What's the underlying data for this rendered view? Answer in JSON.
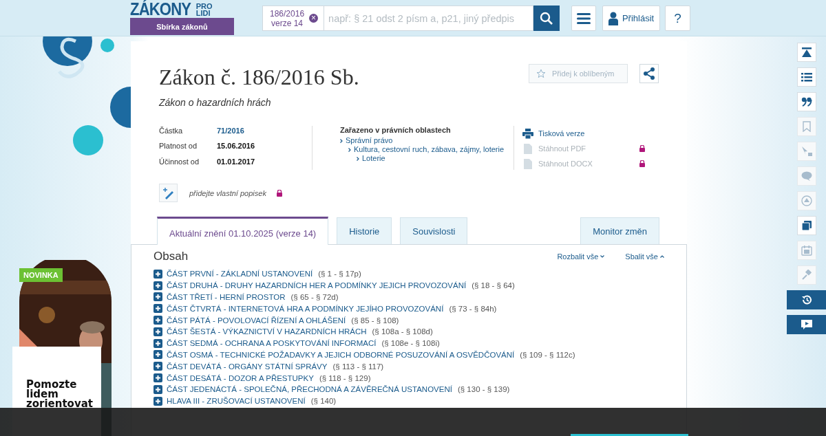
{
  "header": {
    "logo_main": "ZÁKONY",
    "logo_sub": [
      "PRO",
      "LIDI"
    ],
    "collection_button": "Sbírka zákonů",
    "search_chip": {
      "line1": "186/2016",
      "line2": "verze 14",
      "clear": "×"
    },
    "search": {
      "placeholder": "např: § 21 odst 2 písm a, p21, jiný předpis"
    },
    "login": "Přihlásit",
    "help": "?"
  },
  "document": {
    "title": "Zákon č. 186/2016 Sb.",
    "subtitle": "Zákon o hazardních hrách",
    "favorite": "Přidej k oblíbeným",
    "meta": [
      {
        "label": "Částka",
        "value": "71/2016",
        "link": true
      },
      {
        "label": "Platnost od",
        "value": "15.06.2016",
        "link": false
      },
      {
        "label": "Účinnost od",
        "value": "01.01.2017",
        "link": false
      }
    ],
    "areas_heading": "Zařazeno v právních oblastech",
    "areas": [
      {
        "label": "Správní právo",
        "children": [
          {
            "label": "Kultura, cestovní ruch, zábava, zájmy, loterie",
            "children": [
              {
                "label": "Loterie"
              }
            ]
          }
        ]
      }
    ],
    "downloads": [
      {
        "label": "Tisková verze",
        "disabled": false,
        "locked": false
      },
      {
        "label": "Stáhnout PDF",
        "disabled": true,
        "locked": true
      },
      {
        "label": "Stáhnout DOCX",
        "disabled": true,
        "locked": true
      }
    ],
    "note": {
      "text": "přidejte vlastní popisek",
      "locked": true
    }
  },
  "tabs": [
    {
      "label": "Aktuální znění 01.10.2025 (verze 14)",
      "selected": true
    },
    {
      "label": "Historie",
      "selected": false
    },
    {
      "label": "Souvislosti",
      "selected": false
    },
    {
      "label": "Monitor změn",
      "selected": false
    }
  ],
  "toc": {
    "heading": "Obsah",
    "expand_all": "Rozbalit vše",
    "collapse_all": "Sbalit vše",
    "items": [
      {
        "title": "ČÁST PRVNÍ - ZÁKLADNÍ USTANOVENÍ",
        "range": "(§ 1 - § 17p)"
      },
      {
        "title": "ČÁST DRUHÁ - DRUHY HAZARDNÍCH HER A PODMÍNKY JEJICH PROVOZOVÁNÍ",
        "range": "(§ 18 - § 64)"
      },
      {
        "title": "ČÁST TŘETÍ - HERNÍ PROSTOR",
        "range": "(§ 65 - § 72d)"
      },
      {
        "title": "ČÁST ČTVRTÁ - INTERNETOVÁ HRA A PODMÍNKY JEJÍHO PROVOZOVÁNÍ",
        "range": "(§ 73 - § 84h)"
      },
      {
        "title": "ČÁST PÁTÁ - POVOLOVACÍ ŘÍZENÍ A OHLÁŠENÍ",
        "range": "(§ 85 - § 108)"
      },
      {
        "title": "ČÁST ŠESTÁ - VÝKAZNICTVÍ V HAZARDNÍCH HRÁCH",
        "range": "(§ 108a - § 108d)"
      },
      {
        "title": "ČÁST SEDMÁ - OCHRANA A POSKYTOVÁNÍ INFORMACÍ",
        "range": "(§ 108e - § 108i)"
      },
      {
        "title": "ČÁST OSMÁ - TECHNICKÉ POŽADAVKY A JEJICH ODBORNÉ POSUZOVÁNÍ A OSVĚDČOVÁNÍ",
        "range": "(§ 109 - § 112c)"
      },
      {
        "title": "ČÁST DEVÁTÁ - ORGÁNY STÁTNÍ SPRÁVY",
        "range": "(§ 113 - § 117)"
      },
      {
        "title": "ČÁST DESÁTÁ - DOZOR A PŘESTUPKY",
        "range": "(§ 118 - § 129)"
      },
      {
        "title": "ČÁST JEDENÁCTÁ - SPOLEČNÁ, PŘECHODNÁ A ZÁVĚREČNÁ USTANOVENÍ",
        "range": "(§ 130 - § 139)"
      },
      {
        "title": "HLAVA III - ZRUŠOVACÍ USTANOVENÍ",
        "range": "(§ 140)"
      }
    ]
  },
  "rail": [
    {
      "disabled": false,
      "active": false
    },
    {
      "disabled": false,
      "active": false
    },
    {
      "disabled": false,
      "active": false
    },
    {
      "disabled": true,
      "active": false
    },
    {
      "disabled": true,
      "active": false
    },
    {
      "disabled": true,
      "active": false
    },
    {
      "disabled": true,
      "active": false
    },
    {
      "disabled": false,
      "active": false
    },
    {
      "disabled": true,
      "active": false
    },
    {
      "disabled": true,
      "active": false
    },
    {
      "disabled": false,
      "active": true
    },
    {
      "disabled": false,
      "active": true
    }
  ],
  "promo": {
    "badge": "NOVINKA",
    "headline": "Pomozte lidem zorientovat"
  }
}
